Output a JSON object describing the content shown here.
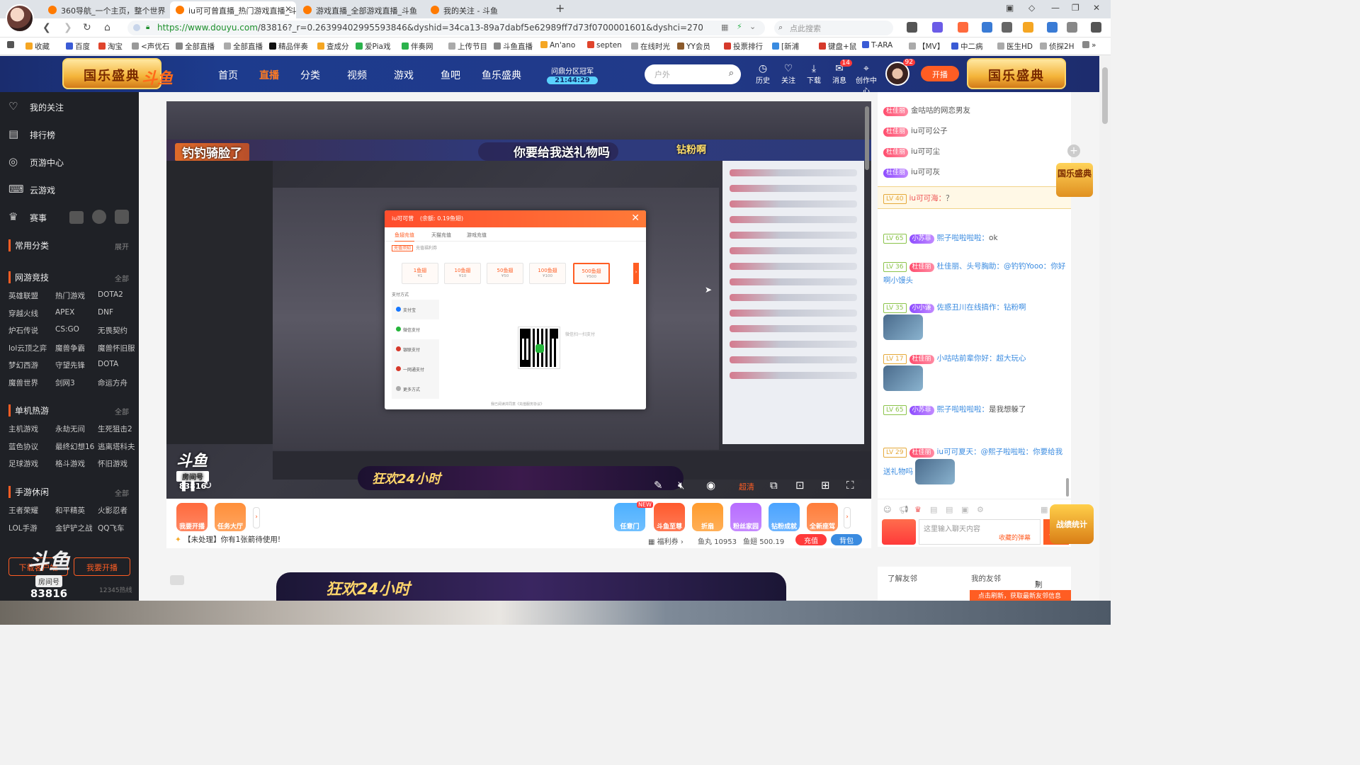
{
  "browser": {
    "tabs": [
      {
        "label": "360导航_一个主页，整个世界",
        "active": false
      },
      {
        "label": "iu可可曾直播_热门游戏直播_斗",
        "active": true
      },
      {
        "label": "游戏直播_全部游戏直播_斗鱼",
        "active": false
      },
      {
        "label": "我的关注 - 斗鱼",
        "active": false
      }
    ],
    "new_tab": "+",
    "url_secure": "https://www.douyu.com",
    "url_rest": "/83816?_r=0.26399402995593846&dyshid=34ca13-89a7dabf5e62989ff7d73f0700001601&dyshci=270",
    "search_placeholder": "点此搜索",
    "bookmarks": [
      "收藏",
      "百度",
      "淘宝",
      "<声优石",
      "全部直播",
      "全部直播",
      "精品伴奏",
      "查成分",
      "爱Pia戏",
      "伴奏网",
      "上传节目",
      "斗鱼直播",
      "An'ano",
      "septen",
      "在线时光",
      "YY会员",
      "投票排行",
      "[新浦",
      "键盘+鼠",
      "T-ARA",
      "【MV】",
      "中二病",
      "医生HD",
      "侦探2H"
    ]
  },
  "header": {
    "festival_left": "国乐盛典",
    "festival_right": "国乐盛典",
    "logo": "斗鱼",
    "nav": [
      "首页",
      "直播",
      "分类",
      "视频",
      "游戏",
      "鱼吧",
      "鱼乐盛典"
    ],
    "active_nav": "直播",
    "champion_label": "问鼎分区冠军",
    "champion_time": "21:44:29",
    "search_placeholder": "户外",
    "icons": [
      {
        "label": "历史",
        "glyph": "◷"
      },
      {
        "label": "关注",
        "glyph": "♡"
      },
      {
        "label": "下载",
        "glyph": "⤓"
      },
      {
        "label": "消息",
        "glyph": "✉",
        "badge": "14"
      },
      {
        "label": "创作中心",
        "glyph": "⌖"
      }
    ],
    "avatar_badge": "92",
    "start_live": "开播"
  },
  "sidebar": {
    "items": [
      {
        "label": "我的关注",
        "icon": "♡"
      },
      {
        "label": "排行榜",
        "icon": "▤"
      },
      {
        "label": "页游中心",
        "icon": "◎"
      },
      {
        "label": "云游戏",
        "icon": "⌨"
      },
      {
        "label": "赛事",
        "icon": "♛"
      }
    ],
    "common": {
      "title": "常用分类",
      "more": "展开"
    },
    "sections": [
      {
        "title": "网游竞技",
        "more": "全部",
        "cats": [
          "英雄联盟",
          "热门游戏",
          "DOTA2",
          "穿越火线",
          "APEX",
          "DNF",
          "炉石传说",
          "CS:GO",
          "无畏契约",
          "lol云顶之弈",
          "魔兽争霸",
          "魔兽怀旧服",
          "梦幻西游",
          "守望先锋",
          "DOTA",
          "魔兽世界",
          "剑网3",
          "命运方舟"
        ]
      },
      {
        "title": "单机热游",
        "more": "全部",
        "cats": [
          "主机游戏",
          "永劫无间",
          "生死狙击2",
          "蓝色协议",
          "最终幻想16",
          "逃离塔科夫",
          "足球游戏",
          "格斗游戏",
          "怀旧游戏"
        ]
      },
      {
        "title": "手游休闲",
        "more": "全部",
        "cats": [
          "王者荣耀",
          "和平精英",
          "火影忍者",
          "LOL手游",
          "金铲铲之战",
          "QQ飞车"
        ]
      }
    ],
    "btn_download": "下载客户端",
    "btn_live": "我要开播",
    "footer_hint": "12345热线",
    "room_logo": "斗鱼",
    "room_label": "房间号",
    "room_number": "83816"
  },
  "player": {
    "banner_left": "钓钓骑脸了",
    "banner_center": "你要给我送礼物吗",
    "banner_right": "钻粉啊",
    "spin_title": "狂欢24小时",
    "room_wm": "斗鱼",
    "room_wm_label": "房间号",
    "room_wm_number": "83816",
    "quality": "超清",
    "modal": {
      "title": "iu可可曾",
      "balance": "(余额: 0.19鱼翅)",
      "tabs": [
        "鱼翅充值",
        "天猫充值",
        "游戏充值"
      ],
      "hint_tag": "充值须知",
      "hint_text": "充值福利券",
      "packages": [
        {
          "name": "1鱼翅",
          "price": "¥1"
        },
        {
          "name": "10鱼翅",
          "price": "¥10"
        },
        {
          "name": "50鱼翅",
          "price": "¥50"
        },
        {
          "name": "100鱼翅",
          "price": "¥100"
        },
        {
          "name": "500鱼翅",
          "price": "¥500"
        }
      ],
      "selected_package": "500鱼翅",
      "pay_title": "支付方式",
      "pay_methods": [
        {
          "label": "支付宝",
          "color": "#1677ff"
        },
        {
          "label": "微信支付",
          "color": "#25b53a"
        },
        {
          "label": "银联支付",
          "color": "#d6392b"
        },
        {
          "label": "一网通支付",
          "color": "#d6392b"
        },
        {
          "label": "更多方式",
          "color": "#aaaaaa"
        }
      ],
      "qr_hint": "微信扫一扫支付",
      "footer": "我已阅读并同意《充值服务协议》"
    }
  },
  "giftbar": {
    "gifts": [
      {
        "label": "我要开播",
        "color": "#ff6a3d"
      },
      {
        "label": "任务大厅",
        "color": "#ff8f3a"
      },
      {
        "label": "任意门",
        "color": "#4db0ff"
      },
      {
        "label": "斗鱼至尊",
        "color": "#ff5a2d"
      },
      {
        "label": "折扇",
        "color": "#ff9b2d"
      },
      {
        "label": "粉丝家园",
        "color": "#b76cff"
      },
      {
        "label": "钻粉成就",
        "color": "#4aa3ff"
      },
      {
        "label": "全新座驾",
        "color": "#ff7d3a"
      }
    ],
    "new_tag": "NEW",
    "notice": "【未处理】你有1张箭待使用!",
    "welfare": "福利券",
    "yuwan_label": "鱼丸",
    "yuwan": "10953",
    "yuchi_label": "鱼翅",
    "yuchi": "500.19",
    "recharge": "充值",
    "backpack": "背包"
  },
  "bottom_banner": "狂欢24小时",
  "chat": {
    "messages": [
      {
        "badge": "杜佳丽",
        "text": "金咕咕的网恋男友",
        "nick": true
      },
      {
        "badge": "杜佳丽",
        "text": "iu可可公子",
        "nick": true
      },
      {
        "badge": "杜佳丽",
        "text": "iu可可尘",
        "nick": true
      },
      {
        "badge": "杜佳丽",
        "text": "iu可可灰",
        "nick": true
      }
    ],
    "highlight": {
      "level": "LV 40",
      "nick": "iu可可海：",
      "text": "？"
    },
    "rows": [
      {
        "level": "LV 65",
        "badge": "小苏菲",
        "nick": "熙子啦啦啦啦：",
        "text": "ok"
      },
      {
        "level": "LV 36",
        "badge": "杜佳丽",
        "nick": "杜佳丽、头号胸助：",
        "text": "@钓钓Yooo：你好啊小馒头"
      },
      {
        "level": "LV 35",
        "badge": "小小谦",
        "nick": "佐惑丑川在线搞作：",
        "text": "钻粉啊"
      },
      {
        "level": "LV 17",
        "badge": "杜佳丽",
        "nick": "小咕咕前辈你好：",
        "text": "超大玩心"
      },
      {
        "level": "LV 65",
        "badge": "小苏菲",
        "nick": "熙子啦啦啦啦：",
        "text": "是我想躲了"
      },
      {
        "level": "LV 29",
        "badge": "杜佳丽",
        "nick": "iu可可夏天：",
        "text": "@熙子啦啦啦：你要给我送礼物吗"
      }
    ],
    "input_placeholder": "这里输入聊天内容",
    "input_hint": "收藏的弹幕",
    "send": "发送",
    "festival": "国乐盛典",
    "stats_badge": "战绩统计"
  },
  "friends": {
    "understand": "了解友邻",
    "mine": "我的友邻",
    "refresh": "刷新",
    "cta": "点击刷新，获取最新友邻信息"
  }
}
